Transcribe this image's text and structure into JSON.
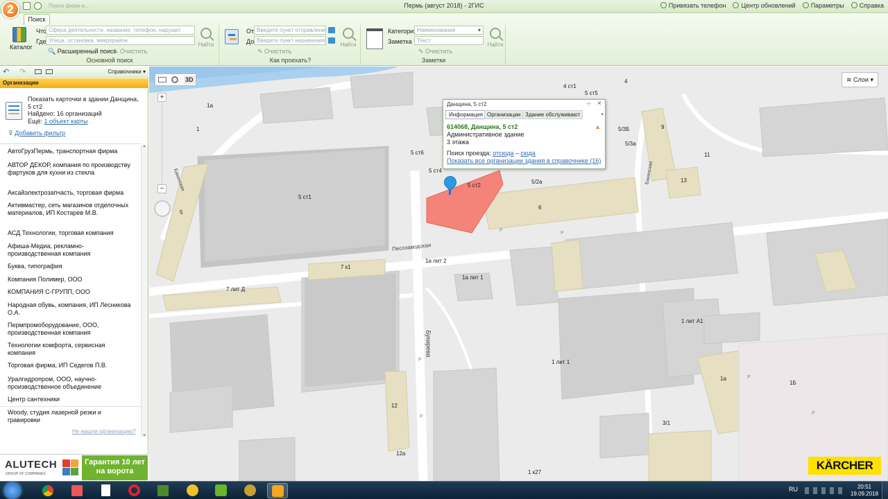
{
  "window": {
    "title": "Пермь (август 2018) - 2ГИС",
    "app_logo": "2",
    "tab_faded": "Поиск фирм и...",
    "right_links": [
      "Привязать телефон",
      "Центр обновлений",
      "Параметры",
      "Справка"
    ]
  },
  "ribbon": {
    "active_tab": "Поиск",
    "main_search": {
      "group_label": "Основной поиск",
      "catalog_label": "Каталог",
      "what_label": "Что",
      "what_placeholder": "Сфера деятельности, название, телефон, нарушит",
      "where_label": "Где",
      "where_placeholder": "Улица, остановка, микрорайон",
      "advanced_label": "Расширенный поиск",
      "clear_label": "Очистить",
      "find_label": "Найти"
    },
    "route": {
      "group_label": "Как проехать?",
      "from_label": "От",
      "from_placeholder": "Введите пункт отправления",
      "to_label": "До",
      "to_placeholder": "Введите пункт назначения",
      "clear_label": "Очистить",
      "find_label": "Найти"
    },
    "notes": {
      "group_label": "Заметки",
      "category_label": "Категория",
      "category_value": "Наименование",
      "note_label": "Заметка",
      "note_placeholder": "Текст",
      "clear_label": "Очистить",
      "find_label": "Найти"
    }
  },
  "left_panel": {
    "directories_label": "Справочники",
    "section_header": "Организации",
    "summary_title": "Показать карточки в здании Данщина, 5 ст2",
    "found_text": "Найдено: 16 организаций",
    "more_prefix": "Ещё:",
    "more_link": "1 объект карты",
    "add_filter": "Добавить фильтр",
    "organizations": [
      "АвтоГрузПермь, транспортная фирма",
      "АВТОР ДЕКОР, компания по производству фартуков для кухни из стекла",
      "Аксайэлектрозапчасть, торговая фирма",
      "Активмастер, сеть магазинов отделочных материалов, ИП Костарев М.В.",
      "АСД Технологии, торговая компания",
      "Афиша-Медиа, рекламно-производственная компания",
      "Буква, типография",
      "Компания Полимер, ООО",
      "КОМПАНИЯ С-ГРУПП, ООО",
      "Народная обувь, компания, ИП Лесникова О.А.",
      "Пермпромоборудование, ООО, производственная компания",
      "Технологии комфорта, сервисная компания",
      "Торговая фирма, ИП Седегов П.В.",
      "Уралгидропром, ООО, научно-производственное объединение",
      "Центр сантехники",
      "Woody, студия лазерной резки и гравировки"
    ],
    "not_found_link": "Не нашли организацию?"
  },
  "ad": {
    "brand": "ALUTECH",
    "brand_sub": "GROUP OF COMPANIES",
    "text": "Гарантия 10 лет на ворота",
    "colors": {
      "green": "#6fb32f"
    }
  },
  "map": {
    "toolbar": {
      "mode_3d": "3D"
    },
    "layers_label": "Слои",
    "karcher": "KÄRCHER",
    "streets": [
      "Песозаводская",
      "Букирева",
      "Бакинская",
      "Бакинская"
    ],
    "building_labels": [
      "1a",
      "1",
      "5 ст1",
      "5 ст6",
      "5 ст4",
      "5 ст2",
      "5/2а",
      "6",
      "5",
      "7 к1",
      "1а лит 2",
      "1а лит 1",
      "7 лит Д",
      "1 лит 1",
      "1 лит А1",
      "12",
      "12а",
      "1 к27",
      "1а",
      "1Б",
      "3/1",
      "9",
      "13",
      "11",
      "5/3Б",
      "5/3а",
      "4 ст1",
      "5 ст5",
      "4",
      "P",
      "P",
      "P",
      "P",
      "P",
      "P"
    ],
    "selected_color": "#f4837a"
  },
  "popup": {
    "title": "Данщина, 5 ст2",
    "tabs": [
      "Информация",
      "Организации",
      "Здание обслуживают"
    ],
    "address": "614068, Данщина, 5 ст2",
    "type": "Административное здание",
    "floors": "3 этажа",
    "route_label": "Поиск проезда:",
    "route_from": "отсюда",
    "route_sep": "–",
    "route_to": "сюда",
    "show_all": "Показать все организации здания в справочнике (16)"
  },
  "taskbar": {
    "lang": "RU",
    "time": "20:51",
    "date": "19.09.2018"
  }
}
